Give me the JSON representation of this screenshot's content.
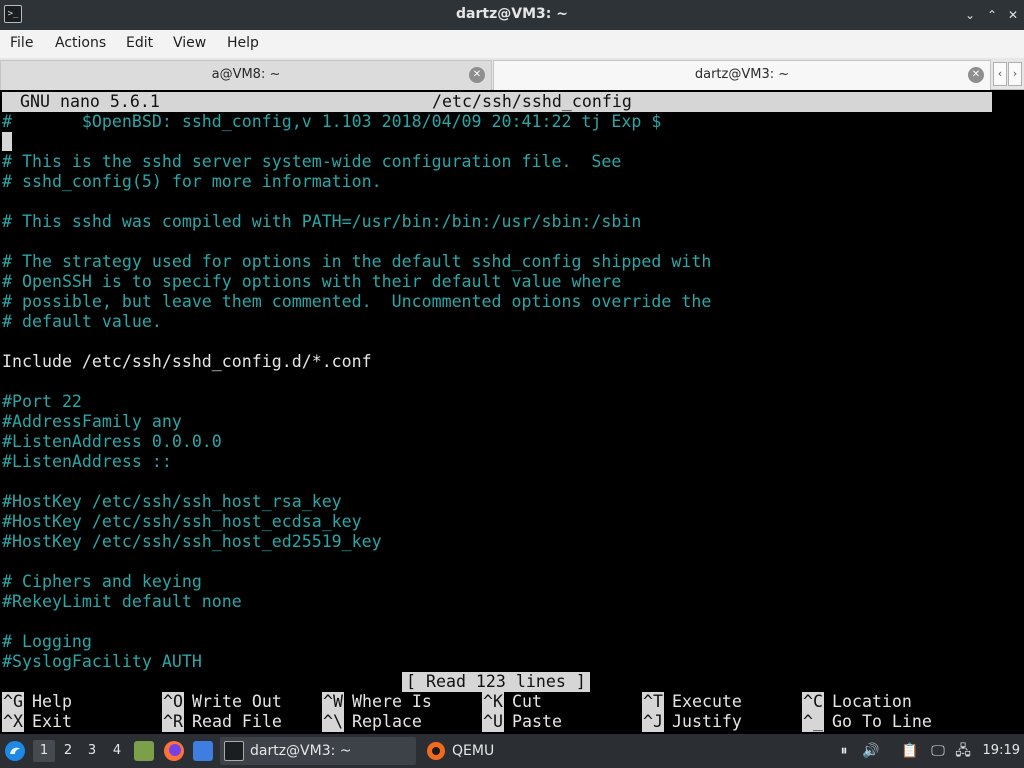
{
  "window": {
    "title": "dartz@VM3: ~",
    "app_icon": "terminal-icon",
    "controls": [
      "minimize-icon",
      "maximize-icon",
      "close-icon"
    ]
  },
  "menubar": [
    "File",
    "Actions",
    "Edit",
    "View",
    "Help"
  ],
  "tabs": [
    {
      "label": "a@VM8: ~",
      "active": false
    },
    {
      "label": "dartz@VM3: ~",
      "active": true
    }
  ],
  "nano": {
    "version": "GNU nano 5.6.1",
    "filename": "/etc/ssh/sshd_config",
    "lines": [
      {
        "text": "#       $OpenBSD: sshd_config,v 1.103 2018/04/09 20:41:22 tj Exp $",
        "kind": "comment"
      },
      {
        "text": "",
        "kind": "blank"
      },
      {
        "text": "# This is the sshd server system-wide configuration file.  See",
        "kind": "comment"
      },
      {
        "text": "# sshd_config(5) for more information.",
        "kind": "comment"
      },
      {
        "text": "",
        "kind": "blank"
      },
      {
        "text": "# This sshd was compiled with PATH=/usr/bin:/bin:/usr/sbin:/sbin",
        "kind": "comment"
      },
      {
        "text": "",
        "kind": "blank"
      },
      {
        "text": "# The strategy used for options in the default sshd_config shipped with",
        "kind": "comment"
      },
      {
        "text": "# OpenSSH is to specify options with their default value where",
        "kind": "comment"
      },
      {
        "text": "# possible, but leave them commented.  Uncommented options override the",
        "kind": "comment"
      },
      {
        "text": "# default value.",
        "kind": "comment"
      },
      {
        "text": "",
        "kind": "blank"
      },
      {
        "text": "Include /etc/ssh/sshd_config.d/*.conf",
        "kind": "plain"
      },
      {
        "text": "",
        "kind": "blank"
      },
      {
        "text": "#Port 22",
        "kind": "comment"
      },
      {
        "text": "#AddressFamily any",
        "kind": "comment"
      },
      {
        "text": "#ListenAddress 0.0.0.0",
        "kind": "comment"
      },
      {
        "text": "#ListenAddress ::",
        "kind": "comment"
      },
      {
        "text": "",
        "kind": "blank"
      },
      {
        "text": "#HostKey /etc/ssh/ssh_host_rsa_key",
        "kind": "comment"
      },
      {
        "text": "#HostKey /etc/ssh/ssh_host_ecdsa_key",
        "kind": "comment"
      },
      {
        "text": "#HostKey /etc/ssh/ssh_host_ed25519_key",
        "kind": "comment"
      },
      {
        "text": "",
        "kind": "blank"
      },
      {
        "text": "# Ciphers and keying",
        "kind": "comment"
      },
      {
        "text": "#RekeyLimit default none",
        "kind": "comment"
      },
      {
        "text": "",
        "kind": "blank"
      },
      {
        "text": "# Logging",
        "kind": "comment"
      },
      {
        "text": "#SyslogFacility AUTH",
        "kind": "comment"
      }
    ],
    "status": "[ Read 123 lines ]",
    "shortcuts_row1": [
      {
        "key": "^G",
        "label": "Help"
      },
      {
        "key": "^O",
        "label": "Write Out"
      },
      {
        "key": "^W",
        "label": "Where Is"
      },
      {
        "key": "^K",
        "label": "Cut"
      },
      {
        "key": "^T",
        "label": "Execute"
      },
      {
        "key": "^C",
        "label": "Location"
      }
    ],
    "shortcuts_row2": [
      {
        "key": "^X",
        "label": "Exit"
      },
      {
        "key": "^R",
        "label": "Read File"
      },
      {
        "key": "^\\",
        "label": "Replace"
      },
      {
        "key": "^U",
        "label": "Paste"
      },
      {
        "key": "^J",
        "label": "Justify"
      },
      {
        "key": "^_",
        "label": "Go To Line"
      }
    ]
  },
  "taskbar": {
    "workspaces": [
      "1",
      "2",
      "3",
      "4"
    ],
    "active_workspace": "1",
    "tasks": [
      {
        "label": "dartz@VM3: ~",
        "icon": "terminal-icon",
        "active": true
      },
      {
        "label": "QEMU",
        "icon": "qemu-icon",
        "active": false
      }
    ],
    "clock": "19:19",
    "colors": {
      "comment": "#2aa6a6",
      "plain": "#e5e5e5",
      "nano_bar": "#d6d6d6"
    }
  }
}
